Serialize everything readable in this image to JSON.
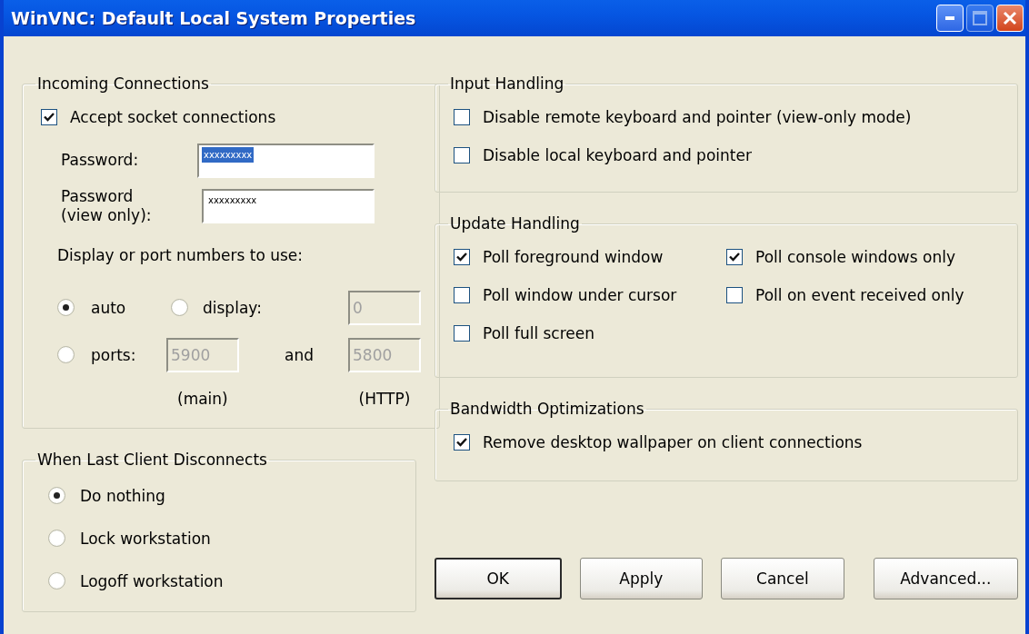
{
  "window": {
    "title": "WinVNC: Default Local System Properties"
  },
  "incoming": {
    "legend": "Incoming Connections",
    "accept": {
      "label": "Accept socket connections",
      "checked": true
    },
    "password": {
      "label": "Password:",
      "value": "xxxxxxxxx",
      "highlighted": true
    },
    "view_password": {
      "label": "Password (view only):",
      "value": "xxxxxxxxx",
      "highlighted": false
    },
    "ports_heading": "Display or port numbers to use:",
    "auto_option": {
      "label": "auto",
      "selected": true
    },
    "display_option": {
      "label": "display:",
      "selected": false
    },
    "display_field": {
      "value": "0",
      "disabled": true
    },
    "ports_option": {
      "label": "ports:",
      "selected": false
    },
    "main_port_field": {
      "value": "5900",
      "disabled": true
    },
    "and_label": "and",
    "http_port_field": {
      "value": "5800",
      "disabled": true
    },
    "main_caption": "(main)",
    "http_caption": "(HTTP)"
  },
  "disconnect": {
    "legend": "When Last Client Disconnects",
    "options": [
      {
        "label": "Do nothing",
        "selected": true
      },
      {
        "label": "Lock workstation",
        "selected": false
      },
      {
        "label": "Logoff workstation",
        "selected": false
      }
    ]
  },
  "input_handling": {
    "legend": "Input Handling",
    "options": [
      {
        "label": "Disable remote keyboard and pointer (view-only mode)",
        "checked": false
      },
      {
        "label": "Disable local keyboard and pointer",
        "checked": false
      }
    ]
  },
  "update_handling": {
    "legend": "Update Handling",
    "options": [
      {
        "label": "Poll foreground window",
        "checked": true
      },
      {
        "label": "Poll console windows only",
        "checked": true
      },
      {
        "label": "Poll window under cursor",
        "checked": false
      },
      {
        "label": "Poll on event received only",
        "checked": false
      },
      {
        "label": "Poll full screen",
        "checked": false
      }
    ]
  },
  "bandwidth": {
    "legend": "Bandwidth Optimizations",
    "options": [
      {
        "label": "Remove desktop wallpaper on client connections",
        "checked": true
      }
    ]
  },
  "buttons": [
    {
      "label": "OK",
      "default": true
    },
    {
      "label": "Apply",
      "default": false
    },
    {
      "label": "Cancel",
      "default": false
    },
    {
      "label": "Advanced...",
      "default": false
    }
  ]
}
